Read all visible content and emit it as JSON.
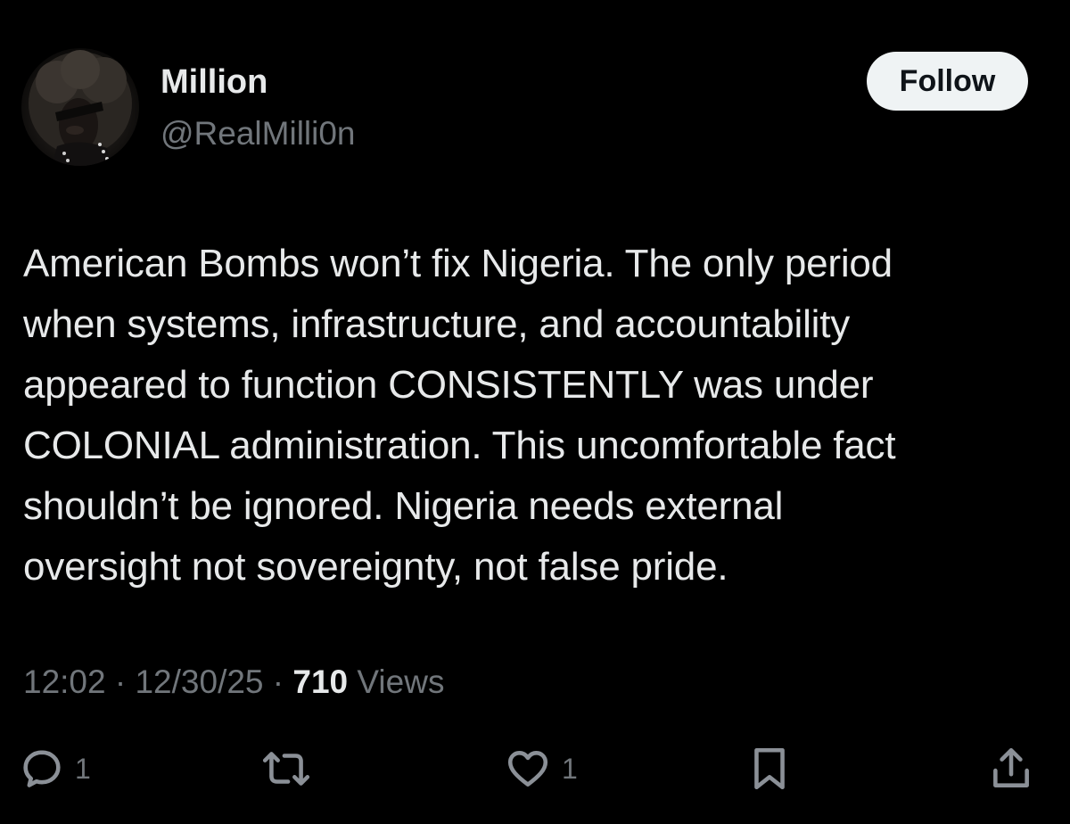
{
  "user": {
    "display_name": "Million",
    "handle": "@RealMilli0n"
  },
  "follow_button": {
    "label": "Follow"
  },
  "tweet": {
    "lines": [
      "American Bombs won’t fix Nigeria. The only period",
      "when systems, infrastructure, and accountability",
      "appeared to function CONSISTENTLY was under",
      "COLONIAL administration. This uncomfortable fact",
      "shouldn’t be ignored. Nigeria needs external",
      "oversight not sovereignty, not false pride."
    ]
  },
  "meta": {
    "time": "12:02",
    "separator": " · ",
    "date": "12/30/25",
    "views_count": "710",
    "views_label": " Views"
  },
  "actions": {
    "reply": {
      "icon": "reply-icon",
      "count": "1"
    },
    "retweet": {
      "icon": "retweet-icon",
      "count": ""
    },
    "like": {
      "icon": "heart-icon",
      "count": "1"
    },
    "bookmark": {
      "icon": "bookmark-icon",
      "count": ""
    },
    "share": {
      "icon": "share-icon",
      "count": ""
    }
  },
  "colors": {
    "background": "#000000",
    "primary_text": "#e7e9ea",
    "secondary_text": "#71767b",
    "follow_button_bg": "#eff3f4",
    "follow_button_text": "#0f1419"
  }
}
